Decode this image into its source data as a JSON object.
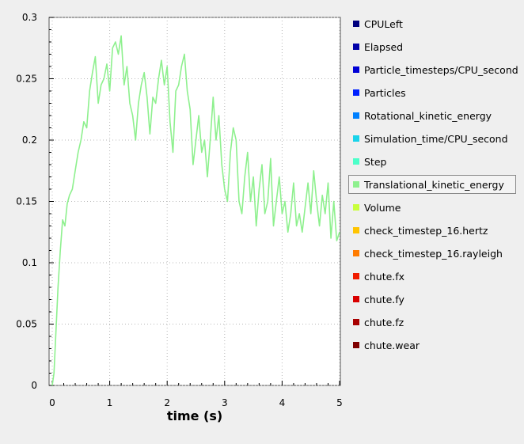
{
  "chart_data": {
    "type": "line",
    "xlabel": "time (s)",
    "ylabel": "",
    "xlim": [
      0,
      5
    ],
    "ylim": [
      0,
      0.3
    ],
    "x_ticks": [
      "0",
      "1",
      "2",
      "3",
      "4",
      "5"
    ],
    "y_ticks": [
      "0",
      "0.05",
      "0.1",
      "0.15",
      "0.2",
      "0.25",
      "0.3"
    ],
    "grid": true,
    "legend_placement": "right",
    "series": [
      {
        "name": "Translational_kinetic_energy",
        "color": "#8ef08e",
        "x": [
          0,
          0.03,
          0.06,
          0.1,
          0.14,
          0.18,
          0.22,
          0.26,
          0.3,
          0.35,
          0.4,
          0.45,
          0.5,
          0.55,
          0.6,
          0.65,
          0.7,
          0.75,
          0.8,
          0.85,
          0.9,
          0.95,
          1.0,
          1.05,
          1.1,
          1.15,
          1.2,
          1.25,
          1.3,
          1.35,
          1.4,
          1.45,
          1.5,
          1.55,
          1.6,
          1.65,
          1.7,
          1.75,
          1.8,
          1.85,
          1.9,
          1.95,
          2.0,
          2.05,
          2.1,
          2.15,
          2.2,
          2.25,
          2.3,
          2.35,
          2.4,
          2.45,
          2.5,
          2.55,
          2.6,
          2.65,
          2.7,
          2.75,
          2.8,
          2.85,
          2.9,
          2.95,
          3.0,
          3.05,
          3.1,
          3.15,
          3.2,
          3.25,
          3.3,
          3.35,
          3.4,
          3.45,
          3.5,
          3.55,
          3.6,
          3.65,
          3.7,
          3.75,
          3.8,
          3.85,
          3.9,
          3.95,
          4.0,
          4.05,
          4.1,
          4.15,
          4.2,
          4.25,
          4.3,
          4.35,
          4.4,
          4.45,
          4.5,
          4.55,
          4.6,
          4.65,
          4.7,
          4.75,
          4.8,
          4.85,
          4.9,
          4.95,
          5.0
        ],
        "y": [
          0.0,
          0.01,
          0.04,
          0.08,
          0.11,
          0.135,
          0.13,
          0.148,
          0.155,
          0.16,
          0.175,
          0.19,
          0.2,
          0.215,
          0.21,
          0.24,
          0.255,
          0.268,
          0.23,
          0.245,
          0.25,
          0.262,
          0.24,
          0.275,
          0.28,
          0.27,
          0.285,
          0.245,
          0.26,
          0.23,
          0.22,
          0.2,
          0.23,
          0.245,
          0.255,
          0.235,
          0.205,
          0.235,
          0.23,
          0.25,
          0.265,
          0.245,
          0.26,
          0.215,
          0.19,
          0.24,
          0.245,
          0.26,
          0.27,
          0.24,
          0.225,
          0.18,
          0.2,
          0.22,
          0.19,
          0.2,
          0.17,
          0.2,
          0.235,
          0.2,
          0.22,
          0.18,
          0.16,
          0.15,
          0.19,
          0.21,
          0.2,
          0.15,
          0.14,
          0.17,
          0.19,
          0.15,
          0.17,
          0.13,
          0.16,
          0.18,
          0.14,
          0.15,
          0.185,
          0.13,
          0.15,
          0.17,
          0.14,
          0.15,
          0.125,
          0.14,
          0.165,
          0.13,
          0.14,
          0.125,
          0.145,
          0.165,
          0.14,
          0.175,
          0.15,
          0.13,
          0.155,
          0.14,
          0.165,
          0.12,
          0.15,
          0.118,
          0.125
        ]
      }
    ]
  },
  "legend": [
    {
      "label": "CPULeft",
      "color": "#00007f"
    },
    {
      "label": "Elapsed",
      "color": "#0000a8"
    },
    {
      "label": "Particle_timesteps/CPU_second",
      "color": "#0000d6"
    },
    {
      "label": "Particles",
      "color": "#0021ff"
    },
    {
      "label": "Rotational_kinetic_energy",
      "color": "#0080ff"
    },
    {
      "label": "Simulation_time/CPU_second",
      "color": "#19d3ea"
    },
    {
      "label": "Step",
      "color": "#4cffc9"
    },
    {
      "label": "Translational_kinetic_energy",
      "color": "#8ef08e",
      "selected": true
    },
    {
      "label": "Volume",
      "color": "#c9ff3b"
    },
    {
      "label": "check_timestep_16.hertz",
      "color": "#ffc400"
    },
    {
      "label": "check_timestep_16.rayleigh",
      "color": "#ff7b00"
    },
    {
      "label": "chute.fx",
      "color": "#f01c00"
    },
    {
      "label": "chute.fy",
      "color": "#d90000"
    },
    {
      "label": "chute.fz",
      "color": "#a80000"
    },
    {
      "label": "chute.wear",
      "color": "#7f0000"
    }
  ]
}
